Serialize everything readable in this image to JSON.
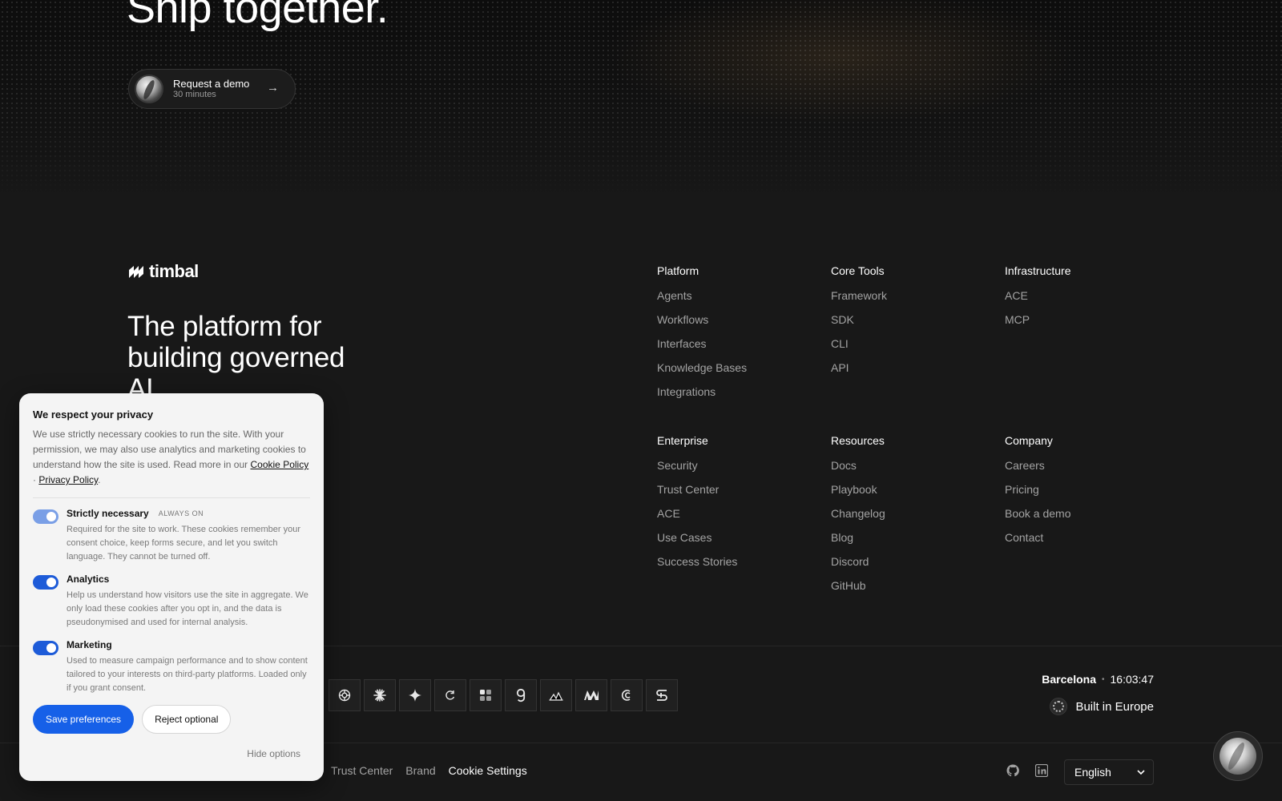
{
  "hero": {
    "title": "Ship together.",
    "demo_button": {
      "title": "Request a demo",
      "subtitle": "30 minutes",
      "arrow": "→"
    }
  },
  "brand": {
    "name": "timbal",
    "tagline": "The platform for building governed AI"
  },
  "columns": [
    {
      "heading": "Platform",
      "links": [
        "Agents",
        "Workflows",
        "Interfaces",
        "Knowledge Bases",
        "Integrations"
      ]
    },
    {
      "heading": "Core Tools",
      "links": [
        "Framework",
        "SDK",
        "CLI",
        "API"
      ]
    },
    {
      "heading": "Infrastructure",
      "links": [
        "ACE",
        "MCP"
      ]
    },
    {
      "heading": "Enterprise",
      "links": [
        "Security",
        "Trust Center",
        "ACE",
        "Use Cases",
        "Success Stories"
      ]
    },
    {
      "heading": "Resources",
      "links": [
        "Docs",
        "Playbook",
        "Changelog",
        "Blog",
        "Discord",
        "GitHub"
      ]
    },
    {
      "heading": "Company",
      "links": [
        "Careers",
        "Pricing",
        "Book a demo",
        "Contact"
      ]
    }
  ],
  "model_icons": [
    "openai-icon",
    "anthropic-icon",
    "gemini-icon",
    "perplexity-icon",
    "mistral-icon",
    "groq-icon",
    "together-icon",
    "cerebras-icon",
    "deepseek-icon",
    "ibm-icon"
  ],
  "location": {
    "city": "Barcelona",
    "separator": "•",
    "time": "16:03:47",
    "built_in": "Built in Europe"
  },
  "bottom_links": [
    "Trust Center",
    "Brand",
    "Cookie Settings"
  ],
  "language": {
    "selected": "English"
  },
  "cookie_banner": {
    "title": "We respect your privacy",
    "intro": "We use strictly necessary cookies to run the site. With your permission, we may also use analytics and marketing cookies to understand how the site is used. Read more in our",
    "cookie_policy_link": "Cookie Policy",
    "dot": "·",
    "privacy_policy_link": "Privacy Policy",
    "period": ".",
    "options": [
      {
        "name": "Strictly necessary",
        "badge": "ALWAYS ON",
        "desc": "Required for the site to work. These cookies remember your consent choice, keep forms secure, and let you switch language. They cannot be turned off."
      },
      {
        "name": "Analytics",
        "badge": "",
        "desc": "Help us understand how visitors use the site in aggregate. We only load these cookies after you opt in, and the data is pseudonymised and used for internal analysis."
      },
      {
        "name": "Marketing",
        "badge": "",
        "desc": "Used to measure campaign performance and to show content tailored to your interests on third-party platforms. Loaded only if you grant consent."
      }
    ],
    "save_label": "Save preferences",
    "reject_label": "Reject optional",
    "hide_label": "Hide options"
  },
  "colors": {
    "background": "#181818",
    "accent": "#1660e8",
    "panel": "#f4f4f4",
    "muted_link": "#a3a3a3"
  }
}
